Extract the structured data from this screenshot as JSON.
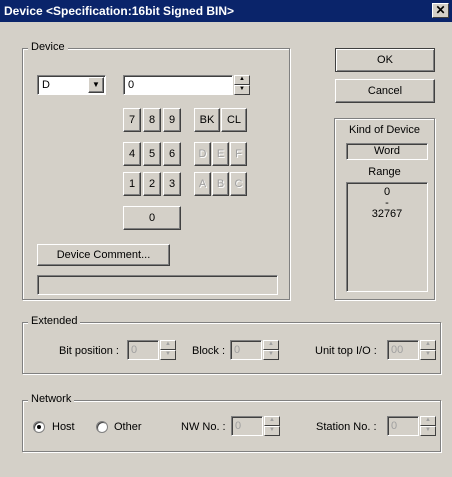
{
  "window": {
    "title": "Device <Specification:16bit Signed BIN>",
    "close": "✕"
  },
  "device_group": {
    "legend": "Device",
    "type_select": "D",
    "value_input": "0",
    "keypad": {
      "row1": [
        "7",
        "8",
        "9"
      ],
      "row1_ops": [
        "BK",
        "CL"
      ],
      "row2": [
        "4",
        "5",
        "6"
      ],
      "row2_hex": [
        "D",
        "E",
        "F"
      ],
      "row3": [
        "1",
        "2",
        "3"
      ],
      "row3_hex": [
        "A",
        "B",
        "C"
      ],
      "zero": "0"
    },
    "comment_button": "Device Comment...",
    "comment_field": ""
  },
  "buttons": {
    "ok": "OK",
    "cancel": "Cancel"
  },
  "info": {
    "kind_label": "Kind of Device",
    "kind_value": "Word",
    "range_label": "Range",
    "range_min": "0",
    "range_sep": "-",
    "range_max": "32767"
  },
  "extended": {
    "legend": "Extended",
    "bit_label": "Bit position :",
    "bit_value": "0",
    "block_label": "Block :",
    "block_value": "0",
    "unit_label": "Unit top I/O :",
    "unit_value": "00"
  },
  "network": {
    "legend": "Network",
    "host_label": "Host",
    "host_selected": true,
    "other_label": "Other",
    "nw_label": "NW No. :",
    "nw_value": "0",
    "station_label": "Station No. :",
    "station_value": "0"
  }
}
